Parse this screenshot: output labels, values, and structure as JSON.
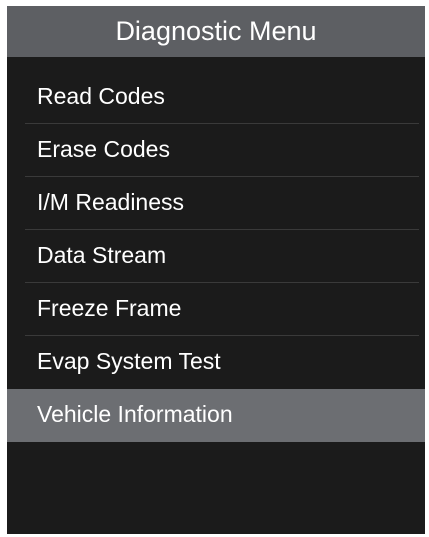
{
  "screen": {
    "title": "Diagnostic Menu"
  },
  "menu": {
    "items": [
      {
        "label": "Read Codes",
        "selected": false
      },
      {
        "label": "Erase Codes",
        "selected": false
      },
      {
        "label": "I/M Readiness",
        "selected": false
      },
      {
        "label": "Data Stream",
        "selected": false
      },
      {
        "label": "Freeze Frame",
        "selected": false
      },
      {
        "label": "Evap System Test",
        "selected": false
      },
      {
        "label": "Vehicle Information",
        "selected": true
      }
    ]
  },
  "colors": {
    "screen_background": "#1b1b1b",
    "title_bar": "#5d5f63",
    "selection_highlight": "#6c6e72",
    "text": "#ffffff",
    "divider": "#3a3a3a"
  }
}
